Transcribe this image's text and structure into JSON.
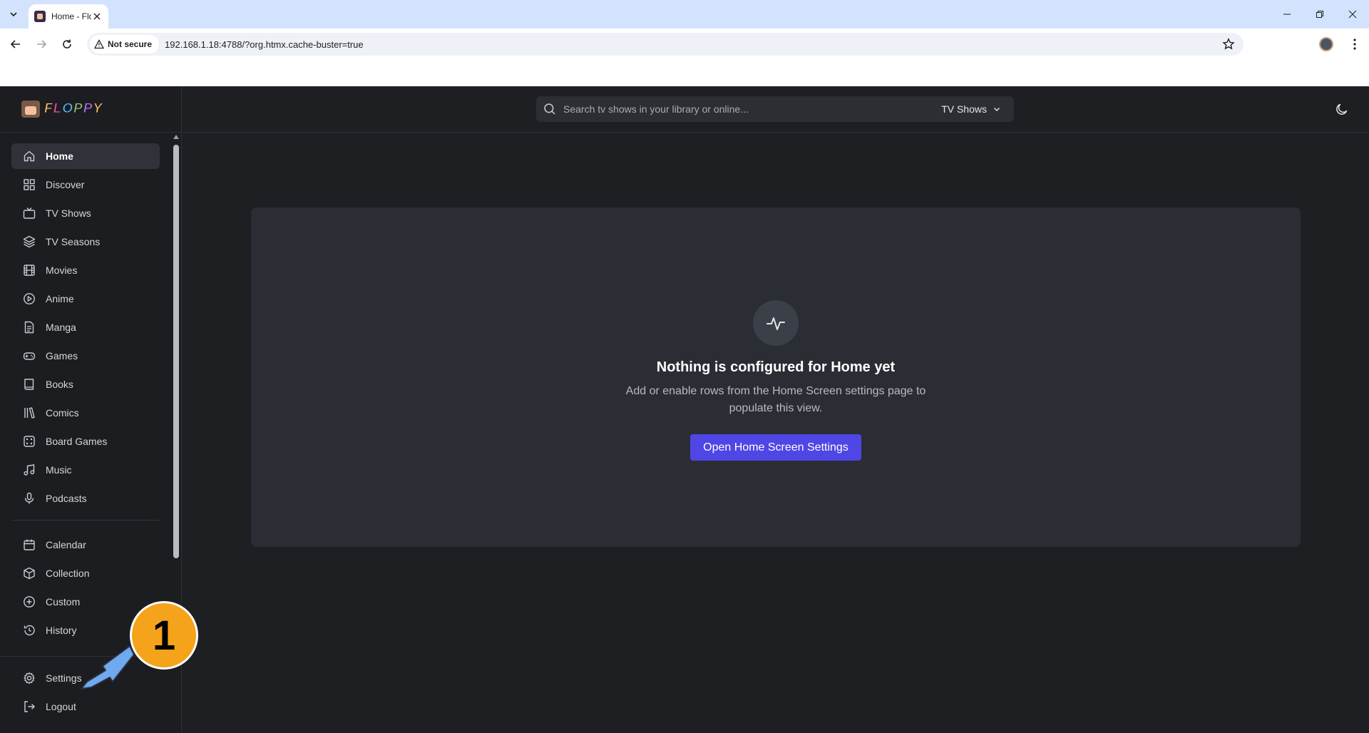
{
  "browser": {
    "tab_title": "Home - Floppy",
    "security_label": "Not secure",
    "url": "192.168.1.18:4788/?org.htmx.cache-buster=true"
  },
  "app": {
    "logo_letters": [
      "F",
      "L",
      "O",
      "P",
      "P",
      "Y"
    ],
    "search": {
      "placeholder": "Search tv shows in your library or online...",
      "media_type": "TV Shows"
    },
    "sidebar": {
      "primary_items": [
        {
          "label": "Home",
          "icon": "home-icon",
          "active": true
        },
        {
          "label": "Discover",
          "icon": "grid-icon"
        },
        {
          "label": "TV Shows",
          "icon": "tv-icon"
        },
        {
          "label": "TV Seasons",
          "icon": "layers-icon"
        },
        {
          "label": "Movies",
          "icon": "film-icon"
        },
        {
          "label": "Anime",
          "icon": "play-circle-icon"
        },
        {
          "label": "Manga",
          "icon": "document-icon"
        },
        {
          "label": "Games",
          "icon": "gamepad-icon"
        },
        {
          "label": "Books",
          "icon": "book-icon"
        },
        {
          "label": "Comics",
          "icon": "library-icon"
        },
        {
          "label": "Board Games",
          "icon": "dice-icon"
        },
        {
          "label": "Music",
          "icon": "music-icon"
        },
        {
          "label": "Podcasts",
          "icon": "microphone-icon"
        }
      ],
      "secondary_items": [
        {
          "label": "Calendar",
          "icon": "calendar-icon"
        },
        {
          "label": "Collection",
          "icon": "box-icon"
        },
        {
          "label": "Custom",
          "icon": "plus-circle-icon"
        },
        {
          "label": "History",
          "icon": "history-icon"
        }
      ],
      "bottom_items": [
        {
          "label": "Settings",
          "icon": "gear-icon"
        },
        {
          "label": "Logout",
          "icon": "logout-icon"
        }
      ]
    },
    "empty_state": {
      "title": "Nothing is configured for Home yet",
      "description": "Add or enable rows from the Home Screen settings page to populate this view.",
      "button_label": "Open Home Screen Settings"
    }
  },
  "annotation": {
    "step_number": "1",
    "color": "#f5a31a"
  }
}
